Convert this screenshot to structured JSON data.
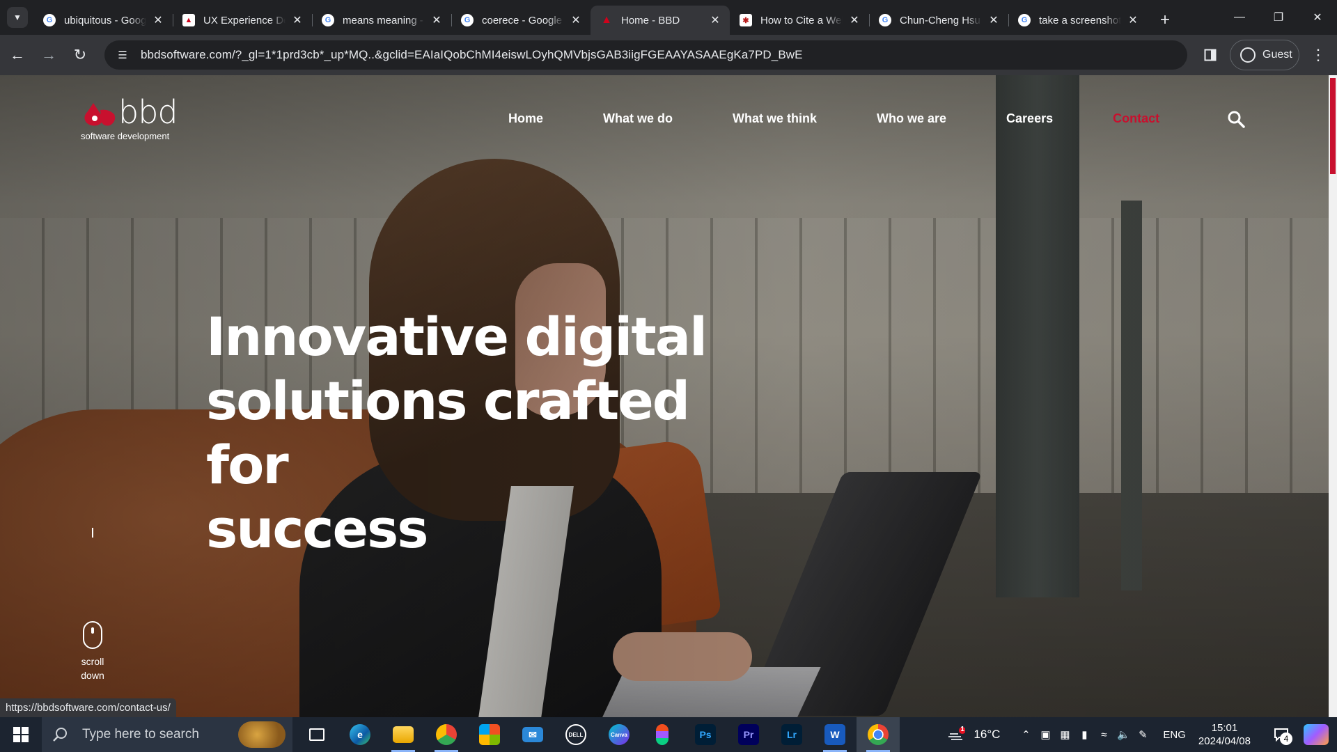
{
  "browser": {
    "tabs": [
      {
        "title": "ubiquitous - Google Search",
        "favicon": "google-icon"
      },
      {
        "title": "UX Experience Design",
        "favicon": "ux-icon"
      },
      {
        "title": "means meaning - Google Search",
        "favicon": "google-icon"
      },
      {
        "title": "coerece - Google Search",
        "favicon": "google-icon"
      },
      {
        "title": "Home - BBD",
        "favicon": "bbd-icon",
        "active": true
      },
      {
        "title": "How to Cite a Website",
        "favicon": "cite-icon"
      },
      {
        "title": "Chun-Cheng Hsu - Google Search",
        "favicon": "google-icon"
      },
      {
        "title": "take a screenshot - Google Search",
        "favicon": "google-icon"
      }
    ],
    "url": "bbdsoftware.com/?_gl=1*1prd3cb*_up*MQ..&gclid=EAIaIQobChMI4eiswLOyhQMVbjsGAB3iigFGEAAYASAAEgKa7PD_BwE",
    "profile_label": "Guest",
    "status_url": "https://bbdsoftware.com/contact-us/"
  },
  "site": {
    "logo_word": "bbd",
    "logo_tagline": "software development",
    "nav": [
      {
        "label": "Home"
      },
      {
        "label": "What we do"
      },
      {
        "label": "What we think"
      },
      {
        "label": "Who we are"
      },
      {
        "label": "Careers"
      },
      {
        "label": "Contact",
        "color": "#c8102e"
      }
    ],
    "hero_lines": [
      "Innovative digital",
      "solutions crafted for",
      "success"
    ],
    "scroll_label": [
      "scroll",
      "down"
    ],
    "accent": "#c8102e"
  },
  "taskbar": {
    "search_placeholder": "Type here to search",
    "apps": [
      "task-view-icon",
      "edge-icon",
      "file-explorer-icon",
      "chrome-alt-icon",
      "store-icon",
      "mail-icon",
      "dell-icon",
      "canva-icon",
      "figma-icon",
      "photoshop-icon",
      "premiere-icon",
      "lightroom-icon",
      "word-icon",
      "chrome-icon"
    ],
    "weather_badge": "1",
    "temperature": "16°C",
    "language": "ENG",
    "time": "15:01",
    "date": "2024/04/08",
    "notification_count": "4"
  }
}
